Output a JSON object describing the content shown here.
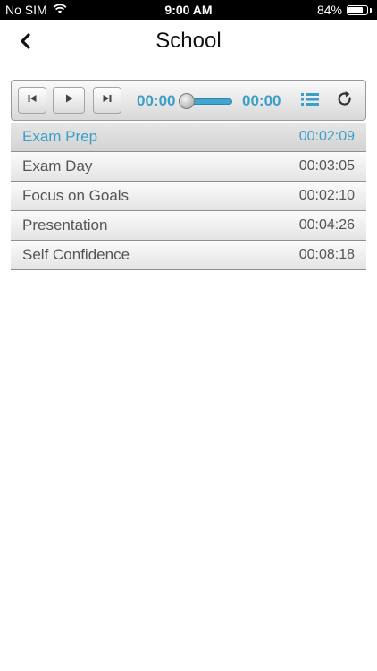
{
  "status_bar": {
    "carrier": "No SIM",
    "time": "9:00 AM",
    "battery_text": "84%",
    "battery_level": 0.84
  },
  "nav": {
    "title": "School",
    "back_icon": "chevron-left-icon"
  },
  "player": {
    "current_time": "00:00",
    "total_time": "00:00",
    "progress": 0,
    "icons": [
      "skip-previous-icon",
      "play-icon",
      "skip-next-icon",
      "playlist-icon",
      "repeat-icon"
    ],
    "accent_color": "#3a9fc9"
  },
  "tracks": [
    {
      "title": "Exam Prep",
      "duration": "00:02:09",
      "active": true
    },
    {
      "title": "Exam Day",
      "duration": "00:03:05",
      "active": false
    },
    {
      "title": "Focus on Goals",
      "duration": "00:02:10",
      "active": false
    },
    {
      "title": "Presentation",
      "duration": "00:04:26",
      "active": false
    },
    {
      "title": "Self Confidence",
      "duration": "00:08:18",
      "active": false
    }
  ]
}
